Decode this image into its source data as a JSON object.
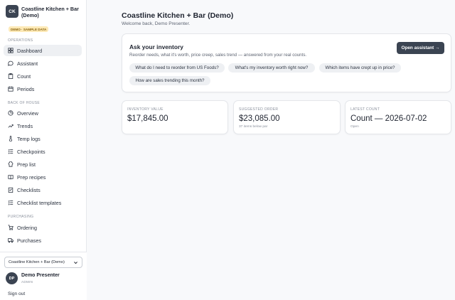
{
  "brand": {
    "initials": "CK",
    "name": "Coastline Kitchen + Bar (Demo)",
    "badge": "DEMO · SAMPLE DATA"
  },
  "sidebar": {
    "sections": {
      "operations": "OPERATIONS",
      "back_of_house": "BACK OF HOUSE",
      "purchasing": "PURCHASING"
    },
    "items": [
      {
        "label": "Dashboard",
        "icon": "grid-icon"
      },
      {
        "label": "Assistant",
        "icon": "chat-icon"
      },
      {
        "label": "Count",
        "icon": "clipboard-icon"
      },
      {
        "label": "Periods",
        "icon": "calendar-icon"
      },
      {
        "label": "Overview",
        "icon": "pie-icon"
      },
      {
        "label": "Trends",
        "icon": "trend-icon"
      },
      {
        "label": "Temp logs",
        "icon": "thermometer-icon"
      },
      {
        "label": "Checkpoints",
        "icon": "list-check-icon"
      },
      {
        "label": "Prep list",
        "icon": "chef-hat-icon"
      },
      {
        "label": "Prep recipes",
        "icon": "book-icon"
      },
      {
        "label": "Checklists",
        "icon": "checklist-icon"
      },
      {
        "label": "Checklist templates",
        "icon": "template-icon"
      },
      {
        "label": "Ordering",
        "icon": "cart-icon"
      },
      {
        "label": "Purchases",
        "icon": "truck-icon"
      }
    ]
  },
  "org_select": {
    "value": "Coastline Kitchen + Bar (Demo)"
  },
  "user": {
    "initials": "DP",
    "name": "Demo Presenter",
    "role": "ADMIN",
    "sign_out": "Sign out"
  },
  "header": {
    "title": "Coastline Kitchen + Bar (Demo)",
    "subtitle": "Welcome back, Demo Presenter."
  },
  "ask": {
    "title": "Ask your inventory",
    "description": "Reorder needs, what it's worth, price creep, sales trend — answered from your real counts.",
    "button": "Open assistant →",
    "chips": [
      "What do I need to reorder from US Foods?",
      "What's my inventory worth right now?",
      "Which items have crept up in price?",
      "How are sales trending this month?"
    ]
  },
  "stats": [
    {
      "label": "INVENTORY VALUE",
      "value": "$17,845.00",
      "sub": ""
    },
    {
      "label": "SUGGESTED ORDER",
      "value": "$23,085.00",
      "sub": "37 items below par"
    },
    {
      "label": "LATEST COUNT",
      "value": "Count — 2026-07-02",
      "sub": "Open"
    }
  ],
  "colors": {
    "accent": "#3b4452",
    "badge_bg": "#fde9b6",
    "chip_bg": "#eef0f3"
  }
}
